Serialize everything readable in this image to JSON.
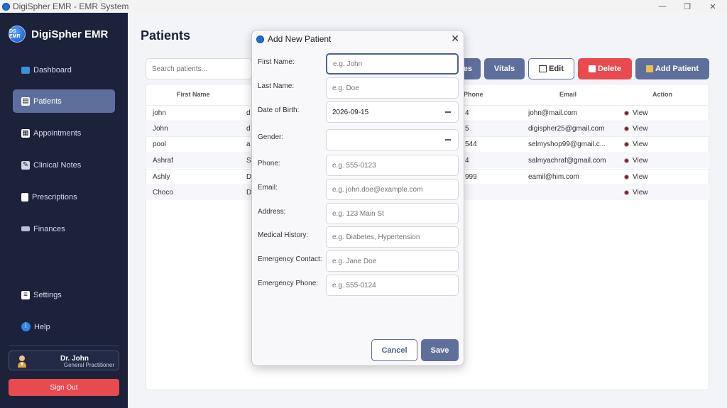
{
  "window": {
    "title": "DigiSpher EMR - EMR System",
    "minimize": "—",
    "maximize": "❐",
    "close": "✕"
  },
  "sidebar": {
    "brand": "DigiSpher EMR",
    "logo_text": "DS EMR",
    "items": [
      {
        "label": "Dashboard",
        "icon": "monitor-icon"
      },
      {
        "label": "Patients",
        "icon": "patients-icon"
      },
      {
        "label": "Appointments",
        "icon": "grid-icon"
      },
      {
        "label": "Clinical Notes",
        "icon": "notes-icon"
      },
      {
        "label": "Prescriptions",
        "icon": "document-icon"
      },
      {
        "label": "Finances",
        "icon": "money-icon"
      },
      {
        "label": "Settings",
        "icon": "settings-icon"
      },
      {
        "label": "Help",
        "icon": "info-icon"
      }
    ],
    "user": {
      "name": "Dr. John",
      "role": "General Practitioner"
    },
    "signout": "Sign Out"
  },
  "main": {
    "title": "Patients",
    "search_placeholder": "Search patients...",
    "toolbar": {
      "notes": "es",
      "vitals": "Vitals",
      "edit": "Edit",
      "delete": "Delete",
      "add": "Add Patient"
    },
    "table": {
      "headers": [
        "First Name",
        "Phone",
        "Email",
        "Action"
      ],
      "rows": [
        {
          "first": "john",
          "last": "d",
          "phone": "4",
          "email": "john@mail.com",
          "action": "View"
        },
        {
          "first": "John",
          "last": "d",
          "phone": "5",
          "email": "digispher25@gmail.com",
          "action": "View"
        },
        {
          "first": "pool",
          "last": "a",
          "phone": "544",
          "email": "selmyshop99@gmail.c...",
          "action": "View"
        },
        {
          "first": "Ashraf",
          "last": "S",
          "phone": "4",
          "email": "salmyachraf@gmail.com",
          "action": "View"
        },
        {
          "first": "Ashly",
          "last": "D",
          "phone": "999",
          "email": "eamil@him.com",
          "action": "View"
        },
        {
          "first": "Choco",
          "last": "D",
          "phone": "",
          "email": "",
          "action": "View"
        }
      ]
    }
  },
  "dialog": {
    "title": "Add New Patient",
    "close": "✕",
    "fields": [
      {
        "label": "First Name:",
        "placeholder": "e.g. John"
      },
      {
        "label": "Last Name:",
        "placeholder": "e.g. Doe"
      },
      {
        "label": "Date of Birth:",
        "value": "2026-09-15"
      },
      {
        "label": "Gender:",
        "value": ""
      },
      {
        "label": "Phone:",
        "placeholder": "e.g. 555-0123"
      },
      {
        "label": "Email:",
        "placeholder": "e.g. john.doe@example.com"
      },
      {
        "label": "Address:",
        "placeholder": "e.g. 123 Main St"
      },
      {
        "label": "Medical History:",
        "placeholder": "e.g. Diabetes, Hypertension"
      },
      {
        "label": "Emergency Contact:",
        "placeholder": "e.g. Jane Doe"
      },
      {
        "label": "Emergency Phone:",
        "placeholder": "e.g. 555-0124"
      }
    ],
    "cancel": "Cancel",
    "save": "Save"
  },
  "colors": {
    "sidebar": "#1c2239",
    "accent": "#5e6f9c",
    "danger": "#e84a4f"
  }
}
